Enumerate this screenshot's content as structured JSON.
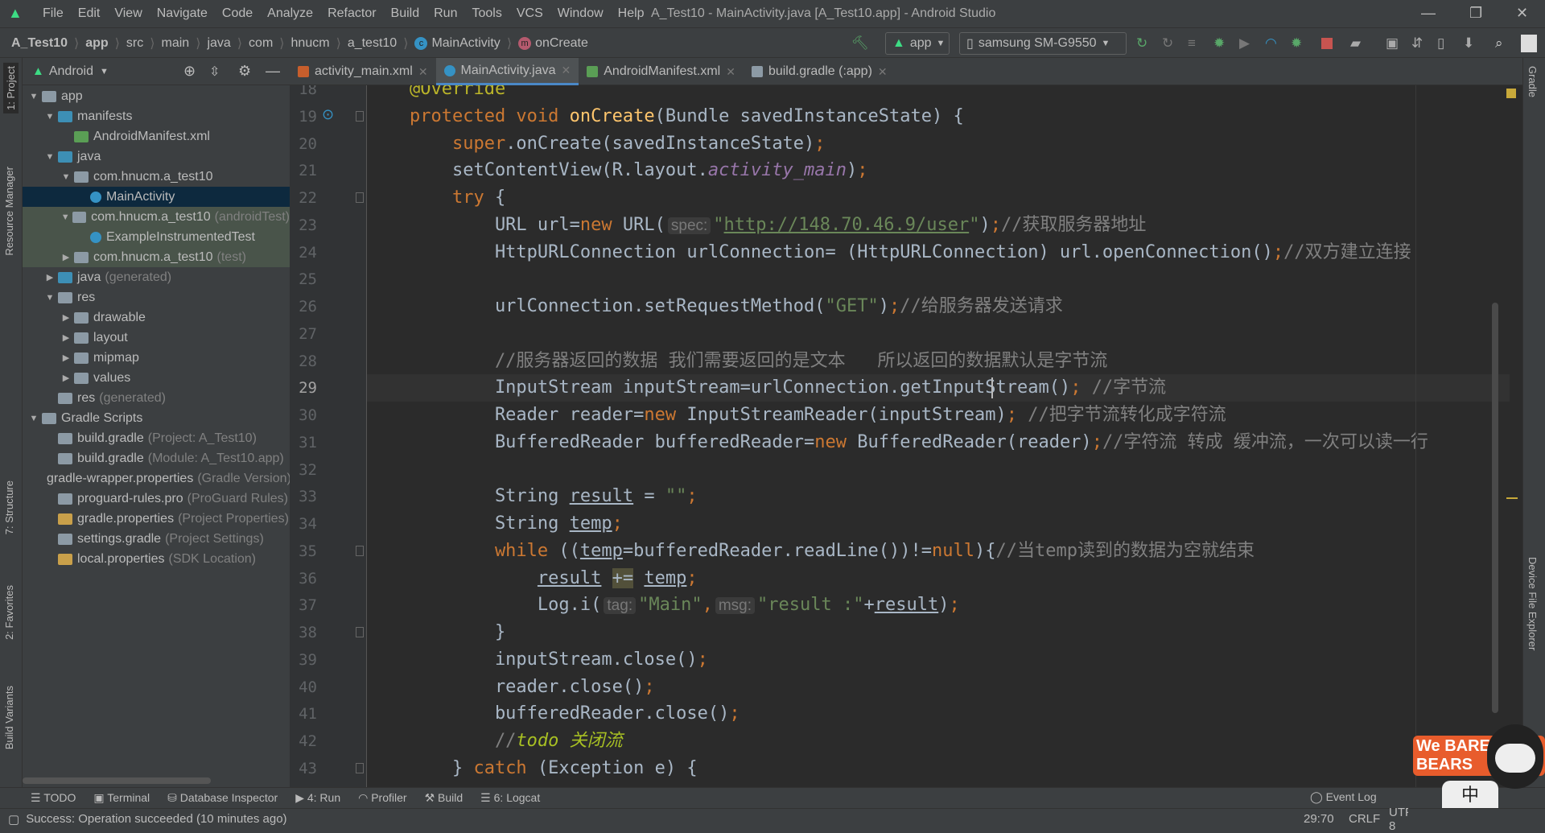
{
  "menu": [
    "File",
    "Edit",
    "View",
    "Navigate",
    "Code",
    "Analyze",
    "Refactor",
    "Build",
    "Run",
    "Tools",
    "VCS",
    "Window",
    "Help"
  ],
  "window_title": "A_Test10 - MainActivity.java [A_Test10.app] - Android Studio",
  "breadcrumb": [
    "A_Test10",
    "app",
    "src",
    "main",
    "java",
    "com",
    "hnucm",
    "a_test10",
    "MainActivity",
    "onCreate"
  ],
  "run_config": "app",
  "device": "samsung SM-G9550",
  "project_view": "Android",
  "left_tabs": [
    "1: Project",
    "Resource Manager",
    "7: Structure",
    "2: Favorites",
    "Build Variants"
  ],
  "right_tabs": [
    "Gradle",
    "Device File Explorer"
  ],
  "tree": [
    {
      "d": 0,
      "arrow": "open",
      "icon": "module",
      "label": "app",
      "hint": ""
    },
    {
      "d": 1,
      "arrow": "open",
      "icon": "folder",
      "label": "manifests",
      "hint": ""
    },
    {
      "d": 2,
      "arrow": "",
      "icon": "manifest",
      "label": "AndroidManifest.xml",
      "hint": ""
    },
    {
      "d": 1,
      "arrow": "open",
      "icon": "folder",
      "label": "java",
      "hint": ""
    },
    {
      "d": 2,
      "arrow": "open",
      "icon": "package",
      "label": "com.hnucm.a_test10",
      "hint": ""
    },
    {
      "d": 3,
      "arrow": "",
      "icon": "class",
      "label": "MainActivity",
      "hint": "",
      "state": "sel"
    },
    {
      "d": 2,
      "arrow": "open",
      "icon": "package",
      "label": "com.hnucm.a_test10",
      "hint": "(androidTest)",
      "state": "testbg"
    },
    {
      "d": 3,
      "arrow": "",
      "icon": "class",
      "label": "ExampleInstrumentedTest",
      "hint": "",
      "state": "testbg"
    },
    {
      "d": 2,
      "arrow": "closed",
      "icon": "package",
      "label": "com.hnucm.a_test10",
      "hint": "(test)",
      "state": "testbg"
    },
    {
      "d": 1,
      "arrow": "closed",
      "icon": "folder",
      "label": "java",
      "hint": "(generated)"
    },
    {
      "d": 1,
      "arrow": "open",
      "icon": "res",
      "label": "res",
      "hint": ""
    },
    {
      "d": 2,
      "arrow": "closed",
      "icon": "package",
      "label": "drawable",
      "hint": ""
    },
    {
      "d": 2,
      "arrow": "closed",
      "icon": "package",
      "label": "layout",
      "hint": ""
    },
    {
      "d": 2,
      "arrow": "closed",
      "icon": "package",
      "label": "mipmap",
      "hint": ""
    },
    {
      "d": 2,
      "arrow": "closed",
      "icon": "package",
      "label": "values",
      "hint": ""
    },
    {
      "d": 1,
      "arrow": "",
      "icon": "res",
      "label": "res",
      "hint": "(generated)"
    },
    {
      "d": 0,
      "arrow": "open",
      "icon": "gradle",
      "label": "Gradle Scripts",
      "hint": ""
    },
    {
      "d": 1,
      "arrow": "",
      "icon": "gradle",
      "label": "build.gradle",
      "hint": "(Project: A_Test10)"
    },
    {
      "d": 1,
      "arrow": "",
      "icon": "gradle",
      "label": "build.gradle",
      "hint": "(Module: A_Test10.app)"
    },
    {
      "d": 1,
      "arrow": "",
      "icon": "props",
      "label": "gradle-wrapper.properties",
      "hint": "(Gradle Version)"
    },
    {
      "d": 1,
      "arrow": "",
      "icon": "file",
      "label": "proguard-rules.pro",
      "hint": "(ProGuard Rules)"
    },
    {
      "d": 1,
      "arrow": "",
      "icon": "props",
      "label": "gradle.properties",
      "hint": "(Project Properties)"
    },
    {
      "d": 1,
      "arrow": "",
      "icon": "gradle",
      "label": "settings.gradle",
      "hint": "(Project Settings)"
    },
    {
      "d": 1,
      "arrow": "",
      "icon": "props",
      "label": "local.properties",
      "hint": "(SDK Location)"
    }
  ],
  "tabs": [
    {
      "label": "activity_main.xml",
      "icon": "xml",
      "active": false
    },
    {
      "label": "MainActivity.java",
      "icon": "class",
      "active": true
    },
    {
      "label": "AndroidManifest.xml",
      "icon": "manifest",
      "active": false
    },
    {
      "label": "build.gradle (:app)",
      "icon": "gradle",
      "active": false
    }
  ],
  "current_line": 29,
  "first_line": 18,
  "code": [
    [
      [
        "a",
        "    @Override"
      ]
    ],
    [
      [
        "k",
        "    protected void "
      ],
      [
        "m",
        "onCreate"
      ],
      [
        "t",
        "(Bundle savedInstanceState) {"
      ]
    ],
    [
      [
        "k",
        "        super"
      ],
      [
        "t",
        ".onCreate(savedInstanceState)"
      ],
      [
        "k",
        ";"
      ]
    ],
    [
      [
        "t",
        "        setContentView(R.layout."
      ],
      [
        "f",
        "activity_main"
      ],
      [
        "t",
        ")"
      ],
      [
        "k",
        ";"
      ]
    ],
    [
      [
        "k",
        "        try "
      ],
      [
        "t",
        "{"
      ]
    ],
    [
      [
        "t",
        "            URL url="
      ],
      [
        "k",
        "new "
      ],
      [
        "t",
        "URL("
      ],
      [
        "h",
        "spec:"
      ],
      [
        "s",
        "\""
      ],
      [
        "u",
        "http://148.70.46.9/user"
      ],
      [
        "s",
        "\""
      ],
      [
        "t",
        ")"
      ],
      [
        "k",
        ";"
      ],
      [
        "c",
        "//获取服务器地址"
      ]
    ],
    [
      [
        "t",
        "            HttpURLConnection urlConnection= (HttpURLConnection) url.openConnection()"
      ],
      [
        "k",
        ";"
      ],
      [
        "c",
        "//双方建立连接"
      ]
    ],
    [],
    [
      [
        "t",
        "            urlConnection.setRequestMethod("
      ],
      [
        "s",
        "\"GET\""
      ],
      [
        "t",
        ")"
      ],
      [
        "k",
        ";"
      ],
      [
        "c",
        "//给服务器发送请求"
      ]
    ],
    [],
    [
      [
        "c",
        "            //服务器返回的数据 我们需要返回的是文本   所以返回的数据默认是字节流"
      ]
    ],
    [
      [
        "t",
        "            InputStream inputStream=urlConnection.getInputStream()"
      ],
      [
        "k",
        "; "
      ],
      [
        "c",
        "//字节流"
      ]
    ],
    [
      [
        "t",
        "            Reader reader="
      ],
      [
        "k",
        "new "
      ],
      [
        "t",
        "InputStreamReader(inputStream)"
      ],
      [
        "k",
        "; "
      ],
      [
        "c",
        "//把字节流转化成字符流"
      ]
    ],
    [
      [
        "t",
        "            BufferedReader bufferedReader="
      ],
      [
        "k",
        "new "
      ],
      [
        "t",
        "BufferedReader(reader)"
      ],
      [
        "k",
        ";"
      ],
      [
        "c",
        "//字符流 转成 缓冲流，一次可以读一行"
      ]
    ],
    [],
    [
      [
        "t",
        "            String "
      ],
      [
        "v",
        "result"
      ],
      [
        "t",
        " = "
      ],
      [
        "s",
        "\"\""
      ],
      [
        "k",
        ";"
      ]
    ],
    [
      [
        "t",
        "            String "
      ],
      [
        "v",
        "temp"
      ],
      [
        "k",
        ";"
      ]
    ],
    [
      [
        "k",
        "            while "
      ],
      [
        "t",
        "(("
      ],
      [
        "v",
        "temp"
      ],
      [
        "t",
        "=bufferedReader.readLine())!="
      ],
      [
        "k",
        "null"
      ],
      [
        "t",
        "){"
      ],
      [
        "c",
        "//当temp读到的数据为空就结束"
      ]
    ],
    [
      [
        "t",
        "                "
      ],
      [
        "v",
        "result"
      ],
      [
        "t",
        " "
      ],
      [
        "op",
        "+="
      ],
      [
        "t",
        " "
      ],
      [
        "v",
        "temp"
      ],
      [
        "k",
        ";"
      ]
    ],
    [
      [
        "t",
        "                Log.i("
      ],
      [
        "h",
        "tag:"
      ],
      [
        "s",
        "\"Main\""
      ],
      [
        "k",
        ","
      ],
      [
        "h",
        "msg:"
      ],
      [
        "s",
        "\"result :\""
      ],
      [
        "t",
        "+"
      ],
      [
        "v",
        "result"
      ],
      [
        "t",
        ")"
      ],
      [
        "k",
        ";"
      ]
    ],
    [
      [
        "t",
        "            }"
      ]
    ],
    [
      [
        "t",
        "            inputStream.close()"
      ],
      [
        "k",
        ";"
      ]
    ],
    [
      [
        "t",
        "            reader.close()"
      ],
      [
        "k",
        ";"
      ]
    ],
    [
      [
        "t",
        "            bufferedReader.close()"
      ],
      [
        "k",
        ";"
      ]
    ],
    [
      [
        "c",
        "            //"
      ],
      [
        "todo",
        "todo 关闭流"
      ]
    ],
    [
      [
        "t",
        "        } "
      ],
      [
        "k",
        "catch "
      ],
      [
        "t",
        "(Exception e) {"
      ]
    ]
  ],
  "bottom_tools": [
    "TODO",
    "Terminal",
    "Database Inspector",
    "4: Run",
    "Profiler",
    "Build",
    "6: Logcat"
  ],
  "event_log": "Event Log",
  "status": {
    "message": "Success: Operation succeeded (10 minutes ago)",
    "position": "29:70",
    "line_sep": "CRLF",
    "encoding": "UTF-8"
  },
  "colors": {
    "keyword": "#cc7832",
    "string": "#6a8759",
    "comment": "#808080",
    "selection": "#0d293e",
    "accent": "#4a88c7"
  }
}
